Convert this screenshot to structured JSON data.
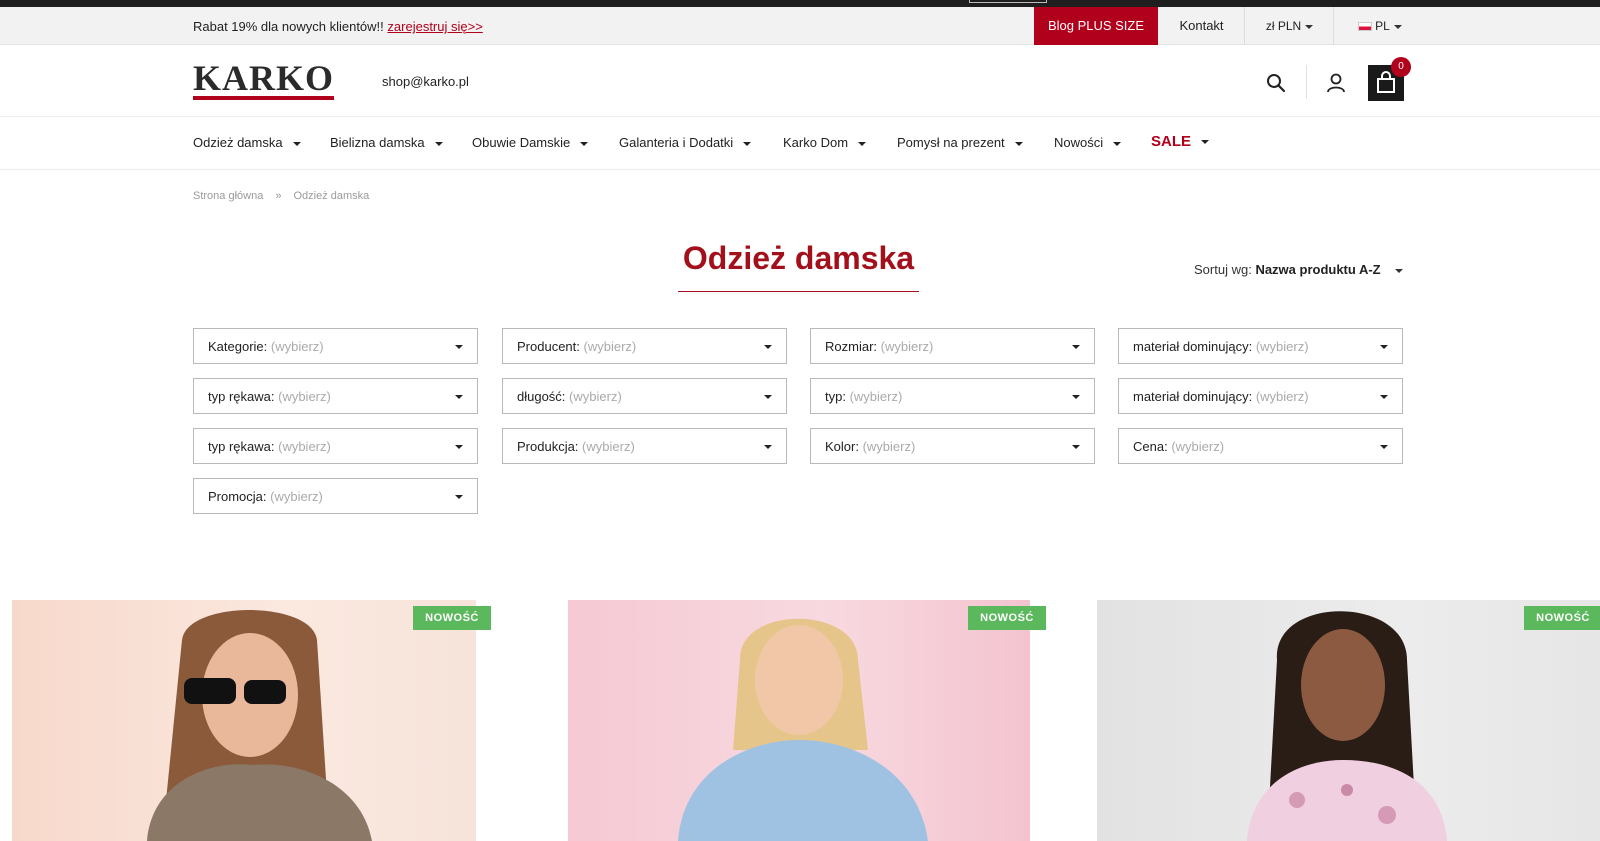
{
  "promo_bar": {
    "message": "Rabat 19% dla nowych klientów!!",
    "register_link": "zarejestruj się>>",
    "blog_label": "Blog PLUS SIZE",
    "contact_label": "Kontakt",
    "currency_label": "zł PLN",
    "language_label": "PL"
  },
  "header": {
    "logo_text": "KARKO",
    "email": "shop@karko.pl",
    "cart_count": "0"
  },
  "nav": {
    "items": [
      {
        "label": "Odzież damska"
      },
      {
        "label": "Bielizna damska"
      },
      {
        "label": "Obuwie Damskie"
      },
      {
        "label": "Galanteria i Dodatki"
      },
      {
        "label": "Karko Dom"
      },
      {
        "label": "Pomysł na prezent"
      },
      {
        "label": "Nowości"
      },
      {
        "label": "SALE"
      }
    ]
  },
  "breadcrumb": {
    "home": "Strona główna",
    "separator": "»",
    "current": "Odzież damska"
  },
  "page": {
    "title": "Odzież damska",
    "sort_prefix": "Sortuj wg:",
    "sort_value": "Nazwa produktu A-Z"
  },
  "filters": [
    {
      "label": "Kategorie:",
      "placeholder": "(wybierz)"
    },
    {
      "label": "Producent:",
      "placeholder": "(wybierz)"
    },
    {
      "label": "Rozmiar:",
      "placeholder": "(wybierz)"
    },
    {
      "label": "materiał dominujący:",
      "placeholder": "(wybierz)"
    },
    {
      "label": "typ rękawa:",
      "placeholder": "(wybierz)"
    },
    {
      "label": "długość:",
      "placeholder": "(wybierz)"
    },
    {
      "label": "typ:",
      "placeholder": "(wybierz)"
    },
    {
      "label": "materiał dominujący:",
      "placeholder": "(wybierz)"
    },
    {
      "label": "typ rękawa:",
      "placeholder": "(wybierz)"
    },
    {
      "label": "Produkcja:",
      "placeholder": "(wybierz)"
    },
    {
      "label": "Kolor:",
      "placeholder": "(wybierz)"
    },
    {
      "label": "Cena:",
      "placeholder": "(wybierz)"
    },
    {
      "label": "Promocja:",
      "placeholder": "(wybierz)"
    }
  ],
  "products": [
    {
      "badge": "NOWOŚĆ"
    },
    {
      "badge": "NOWOŚĆ"
    },
    {
      "badge": "NOWOŚĆ"
    }
  ],
  "colors": {
    "accent": "#b1001c",
    "badge": "#5cb85c"
  }
}
